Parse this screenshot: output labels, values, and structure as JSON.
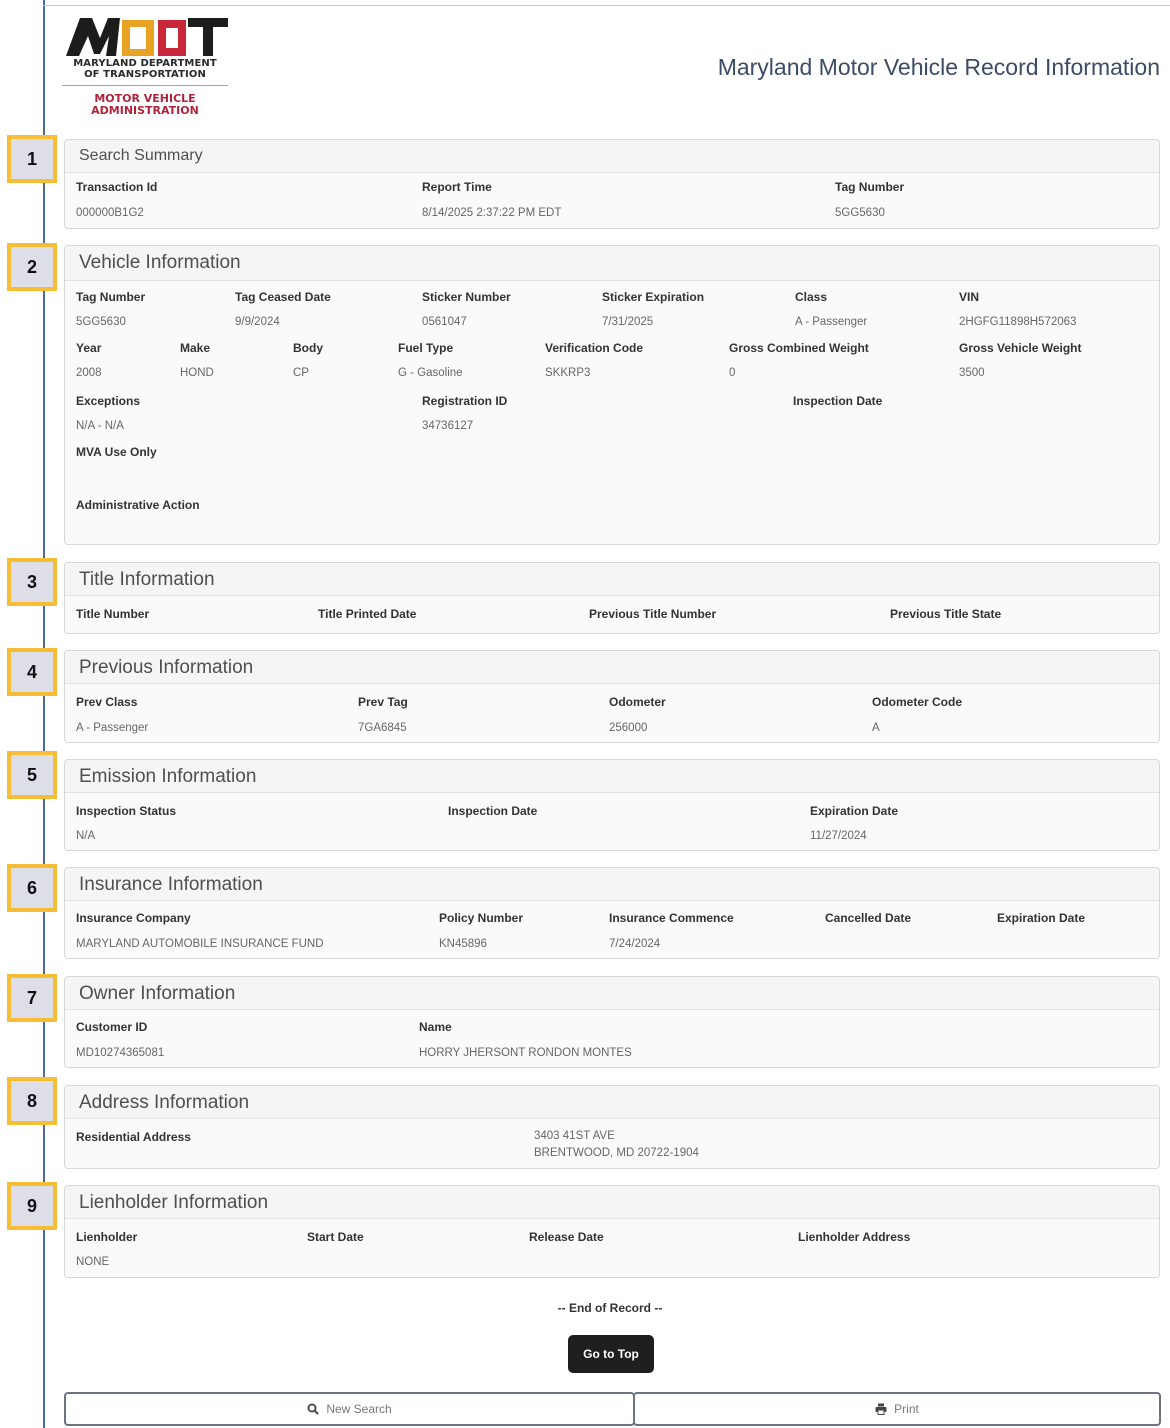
{
  "logo": {
    "mark": "MDOT",
    "line1": "MARYLAND DEPARTMENT",
    "line2": "OF TRANSPORTATION",
    "line3": "MOTOR VEHICLE",
    "line4": "ADMINISTRATION"
  },
  "page_title": "Maryland Motor Vehicle Record Information",
  "badges": [
    "1",
    "2",
    "3",
    "4",
    "5",
    "6",
    "7",
    "8",
    "9"
  ],
  "search_summary": {
    "title": "Search Summary",
    "labels": {
      "transaction_id": "Transaction Id",
      "report_time": "Report Time",
      "tag_number": "Tag Number"
    },
    "values": {
      "transaction_id": "000000B1G2",
      "report_time": "8/14/2025 2:37:22 PM EDT",
      "tag_number": "5GG5630"
    }
  },
  "vehicle": {
    "title": "Vehicle Information",
    "labels": {
      "tag_number": "Tag Number",
      "tag_ceased_date": "Tag Ceased Date",
      "sticker_number": "Sticker Number",
      "sticker_expiration": "Sticker Expiration",
      "class": "Class",
      "vin": "VIN",
      "year": "Year",
      "make": "Make",
      "body": "Body",
      "fuel_type": "Fuel Type",
      "verification_code": "Verification Code",
      "gross_combined_weight": "Gross Combined Weight",
      "gross_vehicle_weight": "Gross Vehicle Weight",
      "exceptions": "Exceptions",
      "registration_id": "Registration ID",
      "inspection_date": "Inspection Date",
      "mva_use_only": "MVA Use Only",
      "administrative_action": "Administrative Action"
    },
    "values": {
      "tag_number": "5GG5630",
      "tag_ceased_date": "9/9/2024",
      "sticker_number": "0561047",
      "sticker_expiration": "7/31/2025",
      "class": "A - Passenger",
      "vin": "2HGFG11898H572063",
      "year": "2008",
      "make": "HOND",
      "body": "CP",
      "fuel_type": "G - Gasoline",
      "verification_code": "SKKRP3",
      "gross_combined_weight": "0",
      "gross_vehicle_weight": "3500",
      "exceptions": "N/A - N/A",
      "registration_id": "34736127"
    }
  },
  "title_info": {
    "title": "Title Information",
    "labels": {
      "title_number": "Title Number",
      "title_printed_date": "Title Printed Date",
      "previous_title_number": "Previous Title Number",
      "previous_title_state": "Previous Title State"
    }
  },
  "previous": {
    "title": "Previous Information",
    "labels": {
      "prev_class": "Prev Class",
      "prev_tag": "Prev Tag",
      "odometer": "Odometer",
      "odometer_code": "Odometer Code"
    },
    "values": {
      "prev_class": "A - Passenger",
      "prev_tag": "7GA6845",
      "odometer": "256000",
      "odometer_code": "A"
    }
  },
  "emission": {
    "title": "Emission Information",
    "labels": {
      "inspection_status": "Inspection Status",
      "inspection_date": "Inspection Date",
      "expiration_date": "Expiration Date"
    },
    "values": {
      "inspection_status": "N/A",
      "expiration_date": "11/27/2024"
    }
  },
  "insurance": {
    "title": "Insurance Information",
    "labels": {
      "company": "Insurance Company",
      "policy_number": "Policy Number",
      "commence": "Insurance Commence",
      "cancelled_date": "Cancelled Date",
      "expiration_date": "Expiration Date"
    },
    "values": {
      "company": "MARYLAND AUTOMOBILE INSURANCE FUND",
      "policy_number": "KN45896",
      "commence": "7/24/2024"
    }
  },
  "owner": {
    "title": "Owner Information",
    "labels": {
      "customer_id": "Customer ID",
      "name": "Name"
    },
    "values": {
      "customer_id": "MD10274365081",
      "name": "HORRY JHERSONT RONDON MONTES"
    }
  },
  "address": {
    "title": "Address Information",
    "labels": {
      "residential": "Residential Address"
    },
    "values": {
      "line1": "3403 41ST AVE",
      "line2": "BRENTWOOD, MD 20722-1904"
    }
  },
  "lienholder": {
    "title": "Lienholder Information",
    "labels": {
      "lienholder": "Lienholder",
      "start_date": "Start Date",
      "release_date": "Release Date",
      "address": "Lienholder Address"
    },
    "values": {
      "lienholder": "NONE"
    }
  },
  "footer": {
    "end_of_record": "-- End of Record --",
    "go_to_top": "Go to Top",
    "new_search": "New Search",
    "print": "Print",
    "icons": {
      "new_search": "search-icon",
      "print": "print-icon"
    }
  },
  "colors": {
    "badge_border": "#f7bd34",
    "badge_fill": "#dedee9",
    "frame": "#4a6a9e",
    "logo_red": "#b0243a",
    "logo_gold": "#e8a325"
  }
}
